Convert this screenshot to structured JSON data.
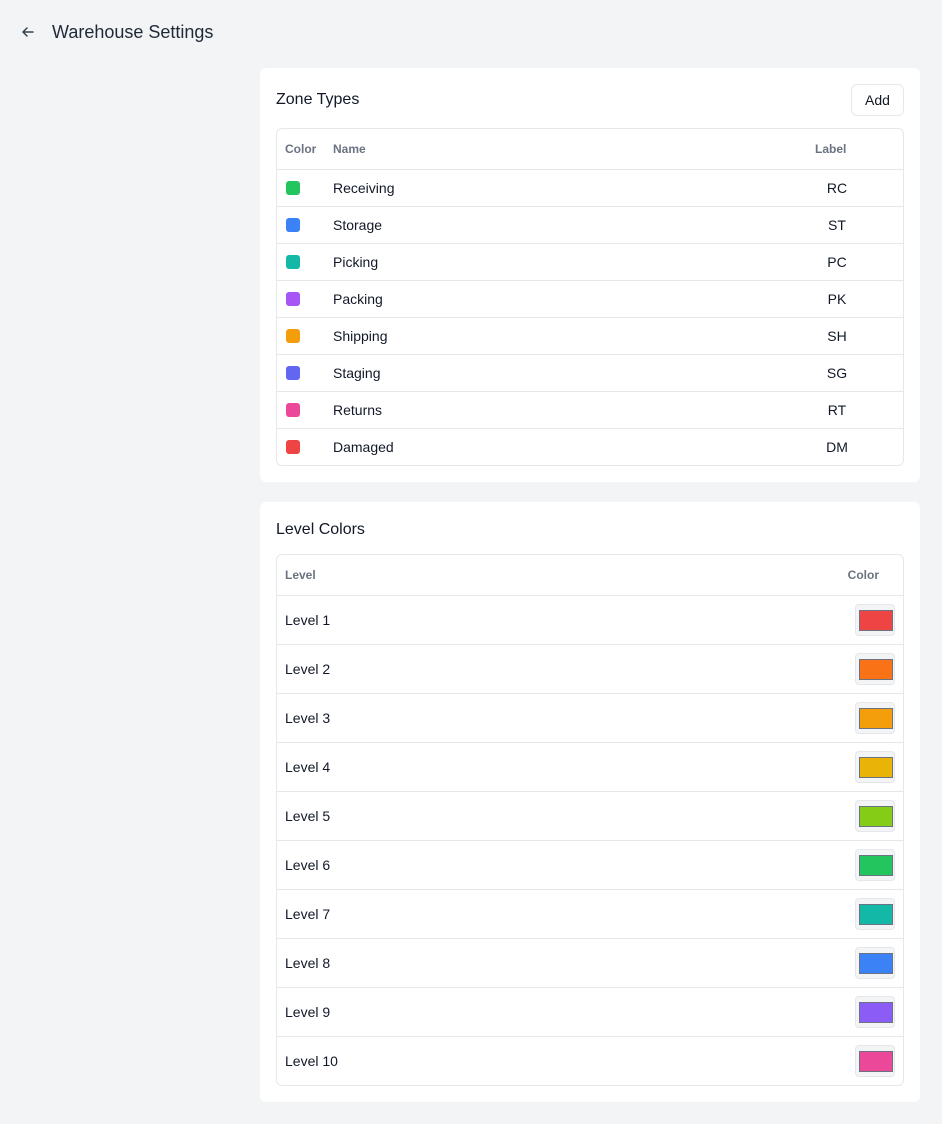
{
  "header": {
    "title": "Warehouse Settings"
  },
  "zone_types": {
    "title": "Zone Types",
    "add_label": "Add",
    "columns": {
      "color": "Color",
      "name": "Name",
      "label": "Label"
    },
    "rows": [
      {
        "name": "Receiving",
        "label": "RC",
        "color": "#22c55e"
      },
      {
        "name": "Storage",
        "label": "ST",
        "color": "#3b82f6"
      },
      {
        "name": "Picking",
        "label": "PC",
        "color": "#14b8a6"
      },
      {
        "name": "Packing",
        "label": "PK",
        "color": "#a855f7"
      },
      {
        "name": "Shipping",
        "label": "SH",
        "color": "#f59e0b"
      },
      {
        "name": "Staging",
        "label": "SG",
        "color": "#6366f1"
      },
      {
        "name": "Returns",
        "label": "RT",
        "color": "#ec4899"
      },
      {
        "name": "Damaged",
        "label": "DM",
        "color": "#ef4444"
      }
    ]
  },
  "level_colors": {
    "title": "Level Colors",
    "columns": {
      "level": "Level",
      "color": "Color"
    },
    "rows": [
      {
        "name": "Level 1",
        "color": "#ef4444"
      },
      {
        "name": "Level 2",
        "color": "#f97316"
      },
      {
        "name": "Level 3",
        "color": "#f59e0b"
      },
      {
        "name": "Level 4",
        "color": "#eab308"
      },
      {
        "name": "Level 5",
        "color": "#84cc16"
      },
      {
        "name": "Level 6",
        "color": "#22c55e"
      },
      {
        "name": "Level 7",
        "color": "#14b8a6"
      },
      {
        "name": "Level 8",
        "color": "#3b82f6"
      },
      {
        "name": "Level 9",
        "color": "#8b5cf6"
      },
      {
        "name": "Level 10",
        "color": "#ec4899"
      }
    ]
  }
}
